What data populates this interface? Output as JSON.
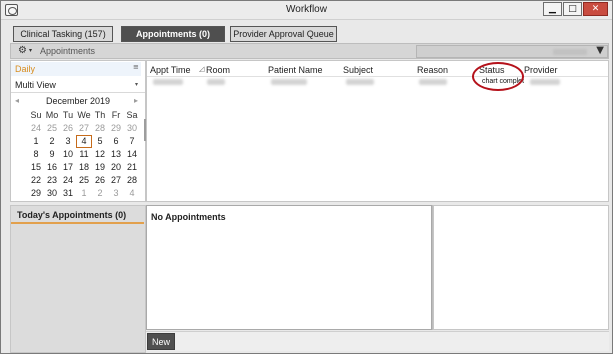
{
  "window": {
    "title": "Workflow",
    "controls": {
      "minimize": "▁",
      "maximize": "□",
      "close": "✕"
    }
  },
  "tabs": [
    {
      "label": "Clinical Tasking (157)",
      "active": false
    },
    {
      "label": "Appointments (0)",
      "active": true
    },
    {
      "label": "Provider Approval Queue",
      "active": false
    }
  ],
  "toolbar": {
    "gear_icon": "⚙",
    "caret": "▾",
    "title": "Appointments",
    "provider_caret": "▼"
  },
  "views": {
    "daily": "Daily",
    "multi": "Multi View",
    "scroll_icon": "≡",
    "multi_caret": "▾"
  },
  "calendar": {
    "prev_icon": "◂",
    "next_icon": "▸",
    "month": "December 2019",
    "weekdays": [
      "Su",
      "Mo",
      "Tu",
      "We",
      "Th",
      "Fr",
      "Sa"
    ],
    "weeks": [
      [
        "24",
        "25",
        "26",
        "27",
        "28",
        "29",
        "30"
      ],
      [
        "1",
        "2",
        "3",
        "4",
        "5",
        "6",
        "7"
      ],
      [
        "8",
        "9",
        "10",
        "11",
        "12",
        "13",
        "14"
      ],
      [
        "15",
        "16",
        "17",
        "18",
        "19",
        "20",
        "21"
      ],
      [
        "22",
        "23",
        "24",
        "25",
        "26",
        "27",
        "28"
      ],
      [
        "29",
        "30",
        "31",
        "1",
        "2",
        "3",
        "4"
      ]
    ],
    "selected": "4"
  },
  "appointments": {
    "columns": [
      "Appt Time",
      "Room",
      "Patient Name",
      "Subject",
      "Reason",
      "Status",
      "Provider"
    ],
    "sort_icon": "◿",
    "row": {
      "status": "chart complet"
    }
  },
  "bottom": {
    "today_label": "Today's Appointments (0)",
    "no_appointments": "No Appointments",
    "new_button": "New"
  },
  "colors": {
    "active_tab_bg": "#4f4f4f",
    "annotation_oval": "#b5121b",
    "daily_highlight": "#d88d1f",
    "close_button": "#c94c40"
  }
}
